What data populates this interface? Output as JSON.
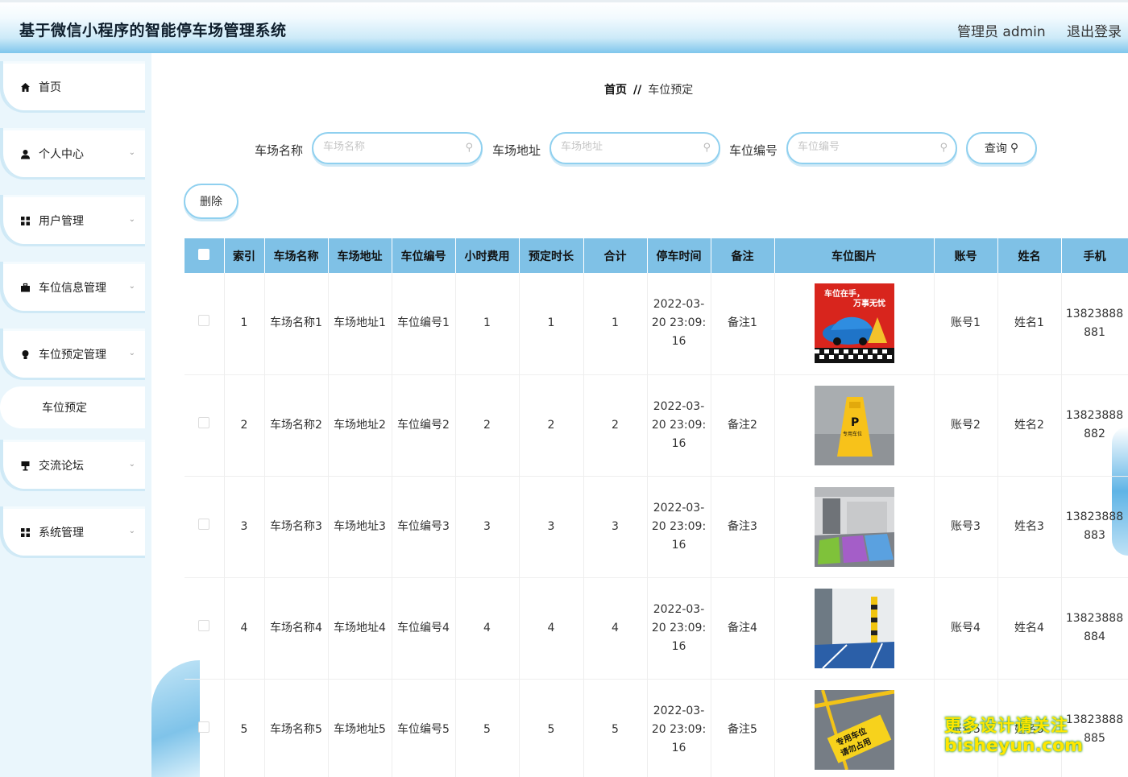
{
  "header": {
    "title": "基于微信小程序的智能停车场管理系统",
    "admin": "管理员 admin",
    "logout": "退出登录"
  },
  "sidebar": {
    "items": [
      {
        "label": "首页"
      },
      {
        "label": "个人中心"
      },
      {
        "label": "用户管理"
      },
      {
        "label": "车位信息管理"
      },
      {
        "label": "车位预定管理"
      },
      {
        "label": "车位预定"
      },
      {
        "label": "交流论坛"
      },
      {
        "label": "系统管理"
      }
    ]
  },
  "breadcrumb": {
    "home": "首页",
    "sep": "//",
    "current": "车位预定"
  },
  "search": {
    "lot_name_label": "车场名称",
    "lot_name_placeholder": "车场名称",
    "lot_addr_label": "车场地址",
    "lot_addr_placeholder": "车场地址",
    "space_no_label": "车位编号",
    "space_no_placeholder": "车位编号",
    "query_label": "查询"
  },
  "actions": {
    "delete_label": "删除"
  },
  "table": {
    "headers": [
      "索引",
      "车场名称",
      "车场地址",
      "车位编号",
      "小时费用",
      "预定时长",
      "合计",
      "停车时间",
      "备注",
      "车位图片",
      "账号",
      "姓名",
      "手机"
    ],
    "rows": [
      {
        "index": "1",
        "name": "车场名称1",
        "addr": "车场地址1",
        "no": "车位编号1",
        "fee": "1",
        "dur": "1",
        "total": "1",
        "time": "2022-03-20 23:09:16",
        "note": "备注1",
        "account": "账号1",
        "uname": "姓名1",
        "phone": "13823888881"
      },
      {
        "index": "2",
        "name": "车场名称2",
        "addr": "车场地址2",
        "no": "车位编号2",
        "fee": "2",
        "dur": "2",
        "total": "2",
        "time": "2022-03-20 23:09:16",
        "note": "备注2",
        "account": "账号2",
        "uname": "姓名2",
        "phone": "13823888882"
      },
      {
        "index": "3",
        "name": "车场名称3",
        "addr": "车场地址3",
        "no": "车位编号3",
        "fee": "3",
        "dur": "3",
        "total": "3",
        "time": "2022-03-20 23:09:16",
        "note": "备注3",
        "account": "账号3",
        "uname": "姓名3",
        "phone": "13823888883"
      },
      {
        "index": "4",
        "name": "车场名称4",
        "addr": "车场地址4",
        "no": "车位编号4",
        "fee": "4",
        "dur": "4",
        "total": "4",
        "time": "2022-03-20 23:09:16",
        "note": "备注4",
        "account": "账号4",
        "uname": "姓名4",
        "phone": "13823888884"
      },
      {
        "index": "5",
        "name": "车场名称5",
        "addr": "车场地址5",
        "no": "车位编号5",
        "fee": "5",
        "dur": "5",
        "total": "5",
        "time": "2022-03-20 23:09:16",
        "note": "备注5",
        "account": "账号5",
        "uname": "姓名5",
        "phone": "13823888885"
      }
    ]
  },
  "images": {
    "pic1": {
      "line1": "车位在手，",
      "line2": "万事无忧"
    },
    "pic2": {
      "sign": "P",
      "sign_text": "专用车位"
    },
    "pic5": {
      "line1": "专用车位",
      "line2": "请勿占用"
    }
  },
  "watermark": {
    "line1": "更多设计请关注",
    "line2": "bisheyun.com"
  },
  "colors": {
    "header_accent": "#7fc6ec",
    "table_head": "#7fc1e6",
    "border_accent": "#8fd0ef"
  }
}
